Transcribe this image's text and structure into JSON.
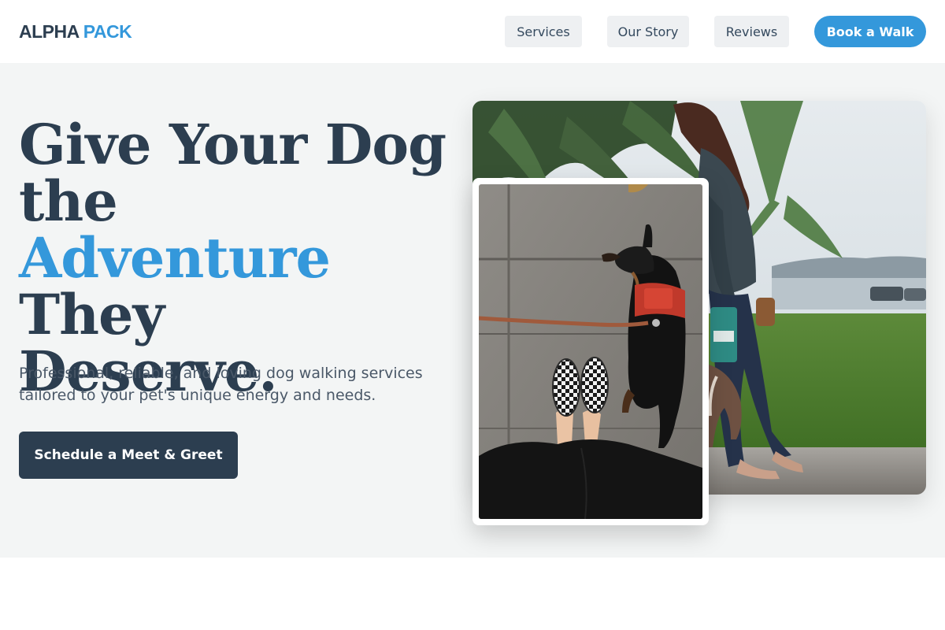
{
  "header": {
    "logo_part1": "ALPHA",
    "logo_part2": "PACK",
    "nav": {
      "services": "Services",
      "our_story": "Our Story",
      "reviews": "Reviews"
    },
    "book_button": "Book a Walk"
  },
  "hero": {
    "headline_line1": "Give Your Dog",
    "headline_line2": "the",
    "headline_accent": "Adventure",
    "headline_line3_rest": " They",
    "headline_line4": "Deserve.",
    "subtitle": "Professional, reliable, and loving dog walking services tailored to your pet's unique energy and needs.",
    "cta_button": "Schedule a Meet & Greet"
  },
  "colors": {
    "brand_dark": "#2c3e50",
    "brand_accent": "#3498db",
    "hero_background": "#f3f5f5",
    "nav_button_bg": "#eef0f2"
  },
  "images": {
    "main_photo": "woman-walking-dog-photo",
    "inset_photo": "dachshund-on-leash-photo"
  }
}
